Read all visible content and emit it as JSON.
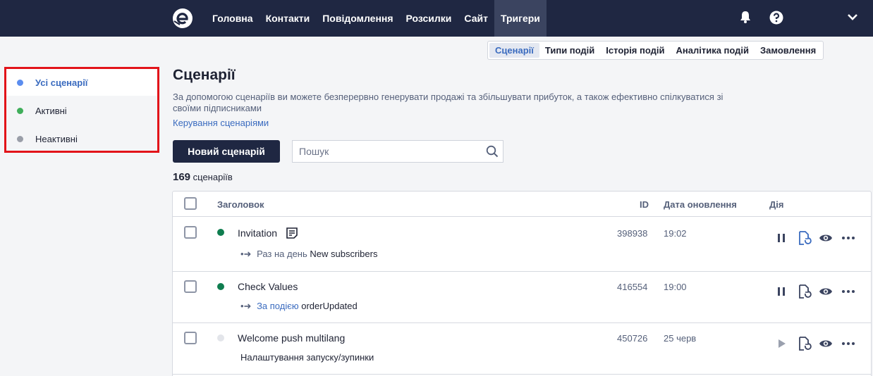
{
  "topbar": {
    "nav": [
      "Головна",
      "Контакти",
      "Повідомлення",
      "Розсилки",
      "Сайт",
      "Тригери"
    ],
    "active": "Тригери"
  },
  "subtabs": [
    "Сценарії",
    "Типи подій",
    "Історія подій",
    "Аналітика подій",
    "Замовлення"
  ],
  "sidebar": {
    "items": [
      {
        "label": "Усі сценарії",
        "color": "#5b8def"
      },
      {
        "label": "Активні",
        "color": "#3fae5a"
      },
      {
        "label": "Неактивні",
        "color": "#9a9ea8"
      }
    ]
  },
  "main": {
    "title": "Сценарії",
    "description": "За допомогою сценаріїв ви можете безперервно генерувати продажі та збільшувати прибуток, а також ефективно спілкуватися зі своїми підписниками",
    "manage_link": "Керування сценаріями",
    "new_button": "Новий сценарій",
    "search_placeholder": "Пошук",
    "count_number": "169",
    "count_label": "сценаріїв"
  },
  "table": {
    "headers": {
      "title": "Заголовок",
      "id": "ID",
      "date": "Дата оновлення",
      "action": "Дія"
    },
    "rows": [
      {
        "name": "Invitation",
        "status_color": "#0f7d4f",
        "trigger_type": "Раз на день",
        "trigger_value": "New subscribers",
        "id": "398938",
        "date": "19:02",
        "state": "active"
      },
      {
        "name": "Check Values",
        "status_color": "#0f7d4f",
        "trigger_type": "За подією",
        "trigger_value": "orderUpdated",
        "id": "416554",
        "date": "19:00",
        "state": "active"
      },
      {
        "name": "Welcome push multilang",
        "status_color": "#e3e5ea",
        "trigger_type": "",
        "trigger_value": "Налаштування запуску/зупинки",
        "id": "450726",
        "date": "25 черв",
        "state": "inactive"
      }
    ]
  },
  "colors": {
    "topbar": "#1f2742",
    "accent": "#3a6bbf",
    "highlight": "#e2141a"
  }
}
